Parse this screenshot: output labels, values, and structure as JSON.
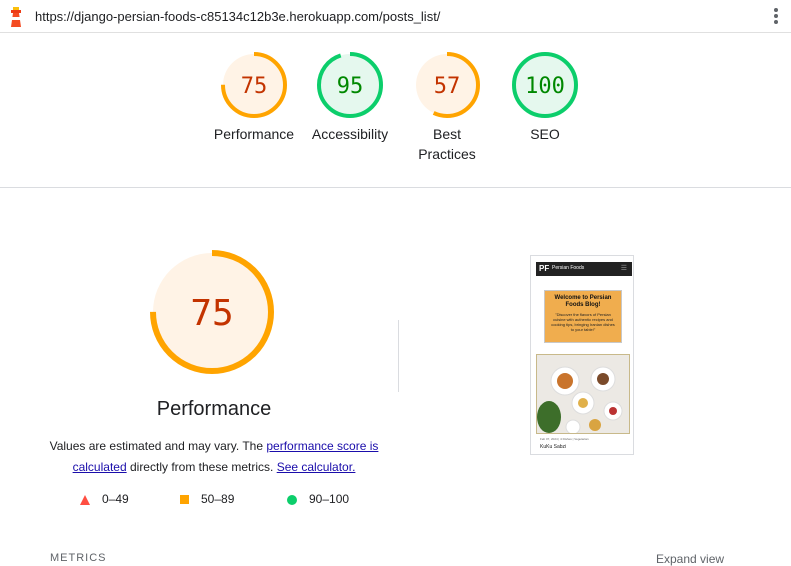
{
  "url_bar": {
    "url": "https://django-persian-foods-c85134c12b3e.herokuapp.com/posts_list/"
  },
  "colors": {
    "orange": "#ffa400",
    "orange_text": "#c33300",
    "green": "#0cce6b",
    "green_text": "#008800",
    "red": "#ff4e42"
  },
  "gauges": [
    {
      "label": "Performance",
      "score": "75",
      "value": 75,
      "status": "average"
    },
    {
      "label": "Accessibility",
      "score": "95",
      "value": 95,
      "status": "pass"
    },
    {
      "label": "Best Practices",
      "score": "57",
      "value": 57,
      "status": "average"
    },
    {
      "label": "SEO",
      "score": "100",
      "value": 100,
      "status": "pass"
    }
  ],
  "performance": {
    "score": "75",
    "value": 75,
    "title": "Performance",
    "desc_before": "Values are estimated and may vary. The ",
    "desc_link1": "performance score is calculated",
    "desc_middle": " directly from these metrics. ",
    "desc_link2": "See calculator."
  },
  "legend": [
    {
      "range": "0–49",
      "icon": "triangle-icon"
    },
    {
      "range": "50–89",
      "icon": "square-icon"
    },
    {
      "range": "90–100",
      "icon": "circle-icon"
    }
  ],
  "thumbnail": {
    "logo": "PF",
    "brand": "Persian Foods",
    "card_title": "Welcome to Persian Foods Blog!",
    "card_text": "\"Discover the flavors of Persian cuisine with authentic recipes and cooking tips, bringing Iranian dishes to your table!\"",
    "meta": "Feb 07, 2024 | 4 Dishes | Vegetarian",
    "post_title": "KuKu Sabzi"
  },
  "footer": {
    "metrics_label": "METRICS",
    "expand_label": "Expand view"
  }
}
